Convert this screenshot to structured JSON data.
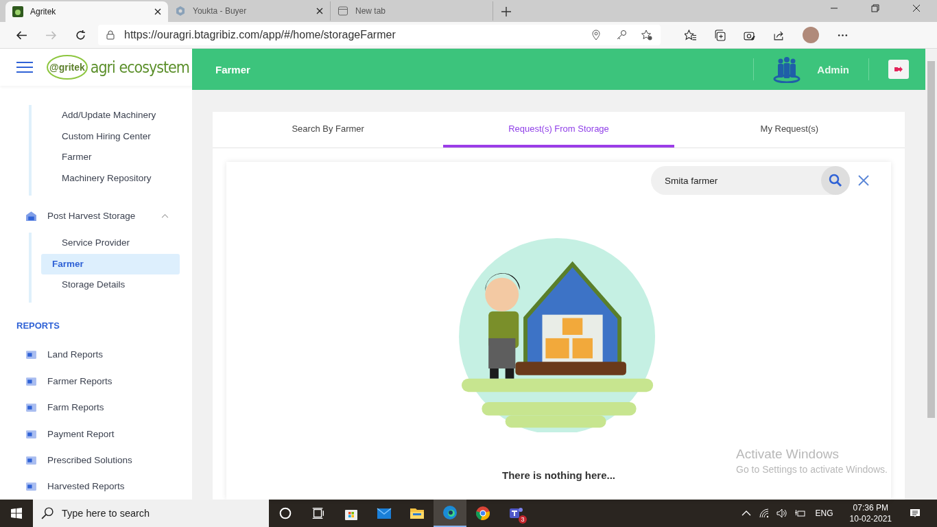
{
  "browser": {
    "tabs": [
      {
        "title": "Agritek",
        "selected": true,
        "kind": "app"
      },
      {
        "title": "Youkta - Buyer",
        "selected": false,
        "kind": "hex"
      },
      {
        "title": "New tab",
        "selected": false,
        "kind": "newtab"
      }
    ],
    "address": {
      "value": "https://ouragri.btagribiz.com/app/#/home/storageFarmer"
    }
  },
  "app": {
    "logo": {
      "badge": "@gritek",
      "text": "agri ecosystem"
    },
    "header": {
      "title": "Farmer",
      "user": "Admin"
    }
  },
  "sidebar": {
    "groups": [
      {
        "items": [
          {
            "label": "Add/Update Machinery",
            "selected": false
          },
          {
            "label": "Custom Hiring Center",
            "selected": false
          },
          {
            "label": "Farmer",
            "selected": false
          },
          {
            "label": "Machinery Repository",
            "selected": false
          }
        ]
      },
      {
        "label": "Post Harvest Storage",
        "expanded": true,
        "items": [
          {
            "label": "Service Provider",
            "selected": false
          },
          {
            "label": "Farmer",
            "selected": true
          },
          {
            "label": "Storage Details",
            "selected": false
          }
        ]
      }
    ],
    "reports": {
      "heading": "REPORTS",
      "items": [
        {
          "label": "Land Reports"
        },
        {
          "label": "Farmer Reports"
        },
        {
          "label": "Farm Reports"
        },
        {
          "label": "Payment Report"
        },
        {
          "label": "Prescribed Solutions"
        },
        {
          "label": "Harvested Reports"
        }
      ]
    }
  },
  "main": {
    "tabs": [
      {
        "label": "Search By Farmer",
        "selected": false
      },
      {
        "label": "Request(s) From Storage",
        "selected": true
      },
      {
        "label": "My Request(s)",
        "selected": false
      }
    ],
    "search": {
      "value": "Smita farmer"
    },
    "empty_message": "There is nothing here..."
  },
  "os_notice": {
    "title": "Activate Windows",
    "subtitle": "Go to Settings to activate Windows."
  },
  "taskbar": {
    "search": {
      "placeholder": "Type here to search"
    },
    "apps": [
      {
        "kind": "cortana",
        "active": false
      },
      {
        "kind": "taskview",
        "active": false
      },
      {
        "kind": "store",
        "active": false
      },
      {
        "kind": "mail",
        "active": false
      },
      {
        "kind": "folder",
        "active": false
      },
      {
        "kind": "edge",
        "active": true
      },
      {
        "kind": "chrome",
        "active": false
      },
      {
        "kind": "teams",
        "active": false,
        "badge": "3"
      }
    ],
    "language": "ENG",
    "time": "07:36 PM",
    "date": "10-02-2021"
  }
}
